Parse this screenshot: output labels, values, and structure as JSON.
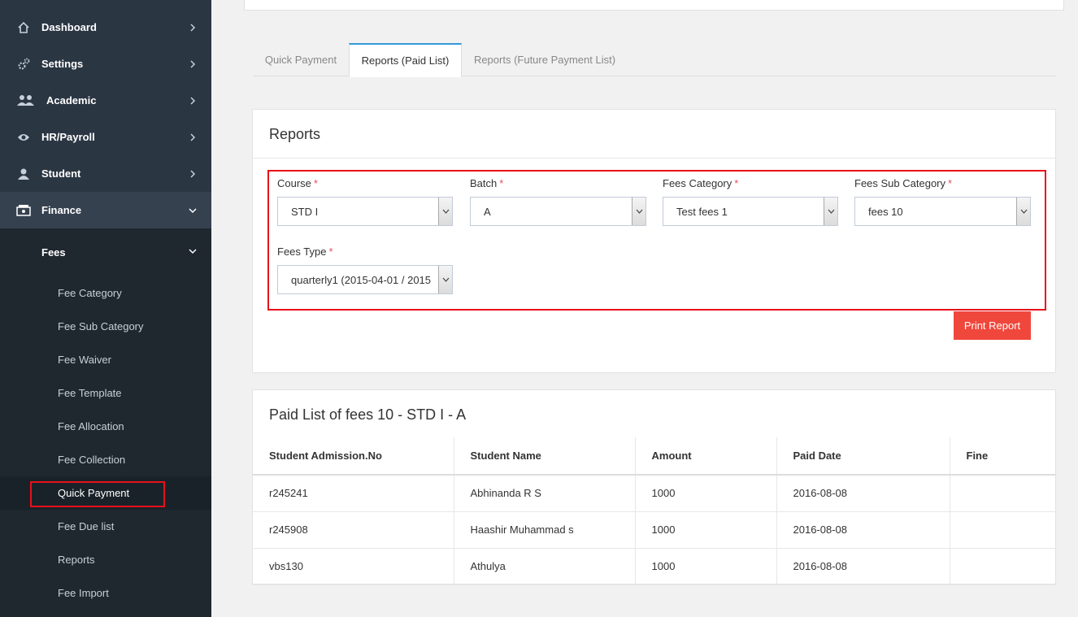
{
  "sidebar": {
    "items": [
      {
        "label": "Dashboard",
        "icon": "home-icon"
      },
      {
        "label": "Settings",
        "icon": "gears-icon"
      },
      {
        "label": "Academic",
        "icon": "users-icon"
      },
      {
        "label": "HR/Payroll",
        "icon": "eye-icon"
      },
      {
        "label": "Student",
        "icon": "user-icon"
      },
      {
        "label": "Finance",
        "icon": "money-icon"
      }
    ],
    "fees": {
      "label": "Fees",
      "items": [
        "Fee Category",
        "Fee Sub Category",
        "Fee Waiver",
        "Fee Template",
        "Fee Allocation",
        "Fee Collection",
        "Quick Payment",
        "Fee Due list",
        "Reports",
        "Fee Import"
      ]
    }
  },
  "tabs": [
    "Quick Payment",
    "Reports (Paid List)",
    "Reports (Future Payment List)"
  ],
  "reports": {
    "title": "Reports",
    "fields": {
      "course": {
        "label": "Course",
        "value": "STD I"
      },
      "batch": {
        "label": "Batch",
        "value": "A"
      },
      "fees_category": {
        "label": "Fees Category",
        "value": "Test fees 1"
      },
      "fees_sub_category": {
        "label": "Fees Sub Category",
        "value": "fees 10"
      },
      "fees_type": {
        "label": "Fees Type",
        "value": "quarterly1 (2015-04-01 / 2015"
      }
    },
    "required_mark": "*",
    "print_label": "Print Report"
  },
  "paid_list": {
    "title": "Paid List of fees 10 - STD I - A",
    "columns": [
      "Student Admission.No",
      "Student Name",
      "Amount",
      "Paid Date",
      "Fine"
    ],
    "rows": [
      [
        "r245241",
        "Abhinanda R S",
        "1000",
        "2016-08-08",
        ""
      ],
      [
        "r245908",
        "Haashir Muhammad s",
        "1000",
        "2016-08-08",
        ""
      ],
      [
        "vbs130",
        "Athulya",
        "1000",
        "2016-08-08",
        ""
      ]
    ]
  },
  "colors": {
    "sidebar": "#2b3643",
    "accent": "#3598dc",
    "danger": "#f0473c",
    "highlight": "#e8111a"
  }
}
